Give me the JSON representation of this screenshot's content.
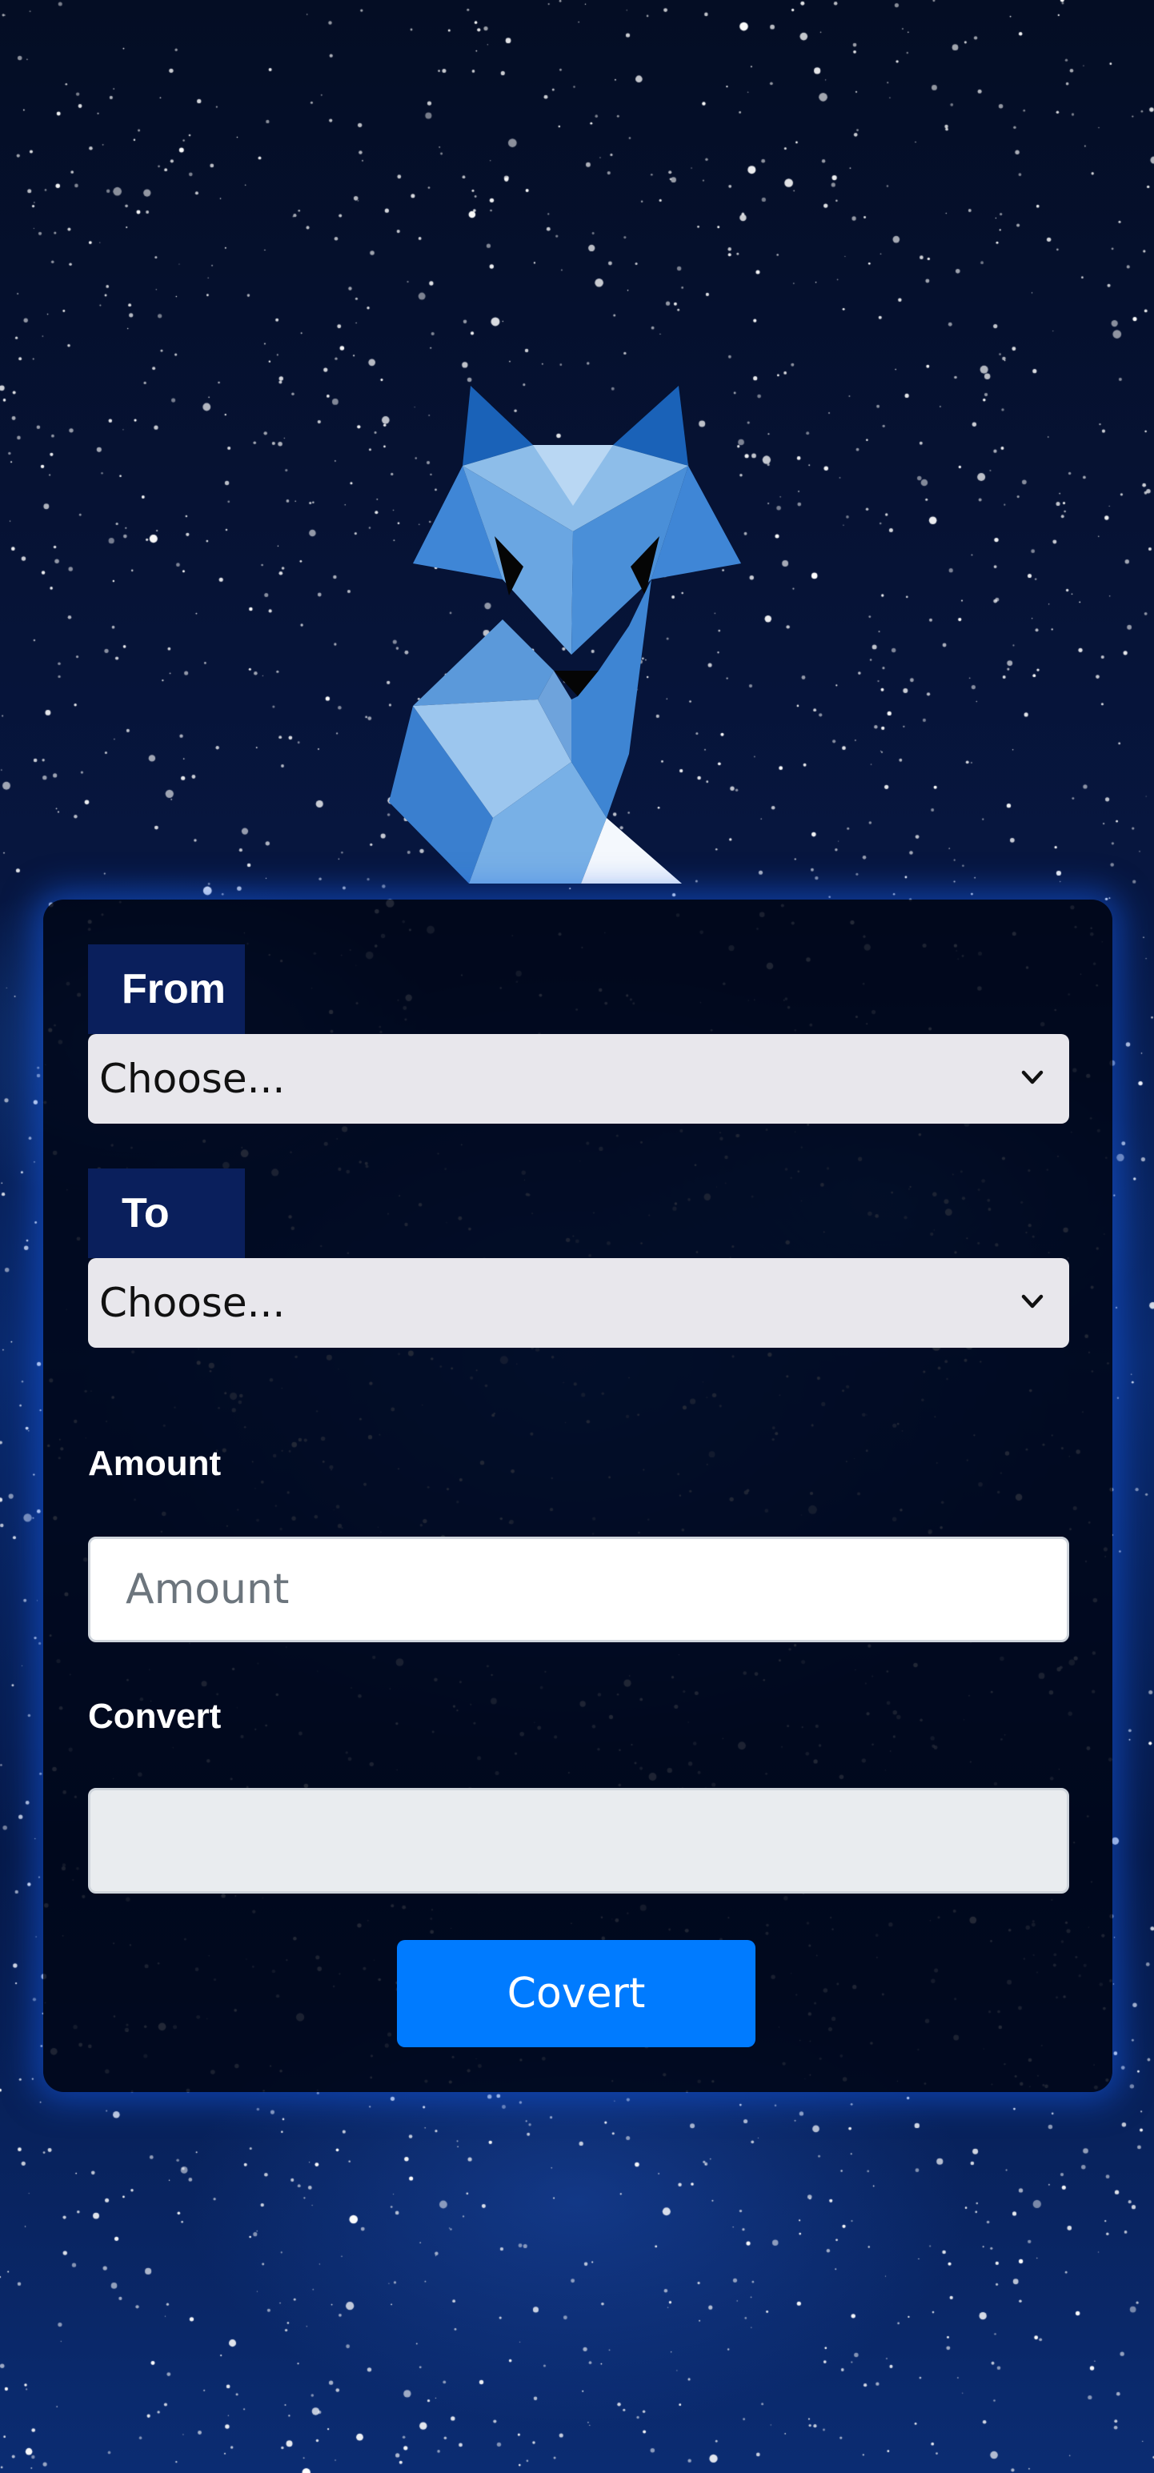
{
  "logo": {
    "icon": "geometric-fox-icon"
  },
  "form": {
    "from_label": "From",
    "from_select": {
      "selected": "Choose...",
      "icon": "chevron-down-icon"
    },
    "to_label": "To",
    "to_select": {
      "selected": "Choose...",
      "icon": "chevron-down-icon"
    },
    "amount_label": "Amount",
    "amount_input": {
      "value": "",
      "placeholder": "Amount"
    },
    "convert_label": "Convert",
    "convert_output": {
      "value": ""
    },
    "submit_label": "Covert"
  },
  "colors": {
    "button": "#007bff",
    "label_tag_bg": "#0a1f5c",
    "card_glow": "#1e5ae6",
    "select_bg": "#e8e7ec"
  }
}
